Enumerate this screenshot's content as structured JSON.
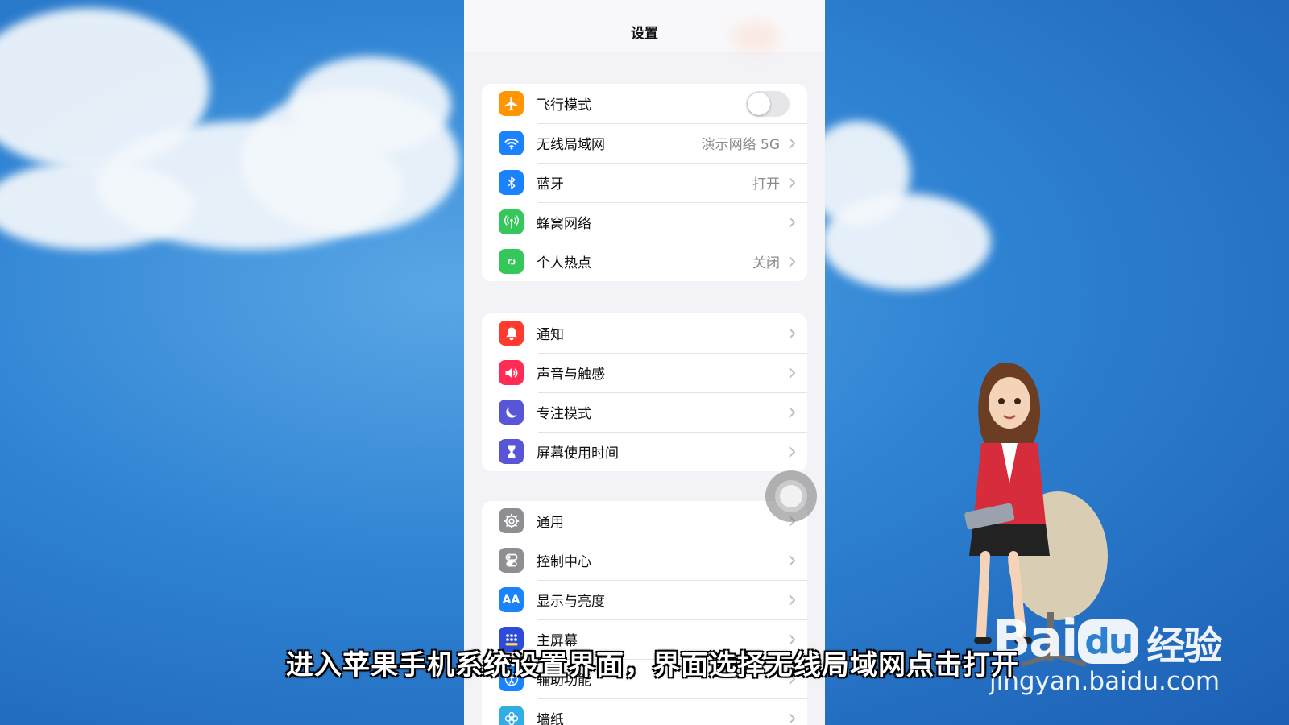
{
  "nav": {
    "title": "设置"
  },
  "groups": [
    {
      "rows": [
        {
          "label": "飞行模式",
          "icon": "airplane-icon",
          "color": "#ff9500",
          "toggle": false
        },
        {
          "label": "无线局域网",
          "icon": "wifi-icon",
          "color": "#1a82fb",
          "value": "演示网络 5G"
        },
        {
          "label": "蓝牙",
          "icon": "bluetooth-icon",
          "color": "#1a82fb",
          "value": "打开"
        },
        {
          "label": "蜂窝网络",
          "icon": "antenna-icon",
          "color": "#34c759"
        },
        {
          "label": "个人热点",
          "icon": "hotspot-icon",
          "color": "#34c759",
          "value": "关闭"
        }
      ]
    },
    {
      "rows": [
        {
          "label": "通知",
          "icon": "bell-icon",
          "color": "#ff3b30"
        },
        {
          "label": "声音与触感",
          "icon": "speaker-icon",
          "color": "#ff2d55"
        },
        {
          "label": "专注模式",
          "icon": "moon-icon",
          "color": "#5856d6"
        },
        {
          "label": "屏幕使用时间",
          "icon": "hourglass-icon",
          "color": "#5856d6"
        }
      ]
    },
    {
      "rows": [
        {
          "label": "通用",
          "icon": "gear-icon",
          "color": "#8e8e93"
        },
        {
          "label": "控制中心",
          "icon": "switches-icon",
          "color": "#8e8e93"
        },
        {
          "label": "显示与亮度",
          "icon": "text-size-icon",
          "color": "#1a82fb",
          "glyph": "AA"
        },
        {
          "label": "主屏幕",
          "icon": "home-grid-icon",
          "color": "#2c4bd8"
        },
        {
          "label": "辅助功能",
          "icon": "accessibility-icon",
          "color": "#1a82fb"
        },
        {
          "label": "墙纸",
          "icon": "flower-icon",
          "color": "#32ade6"
        }
      ]
    }
  ],
  "subtitle": "进入苹果手机系统设置界面，界面选择无线局域网点击打开",
  "watermark": {
    "brand_a": "Bai",
    "brand_b": "du",
    "brand_c": "经验",
    "url": "jingyan.baidu.com"
  }
}
